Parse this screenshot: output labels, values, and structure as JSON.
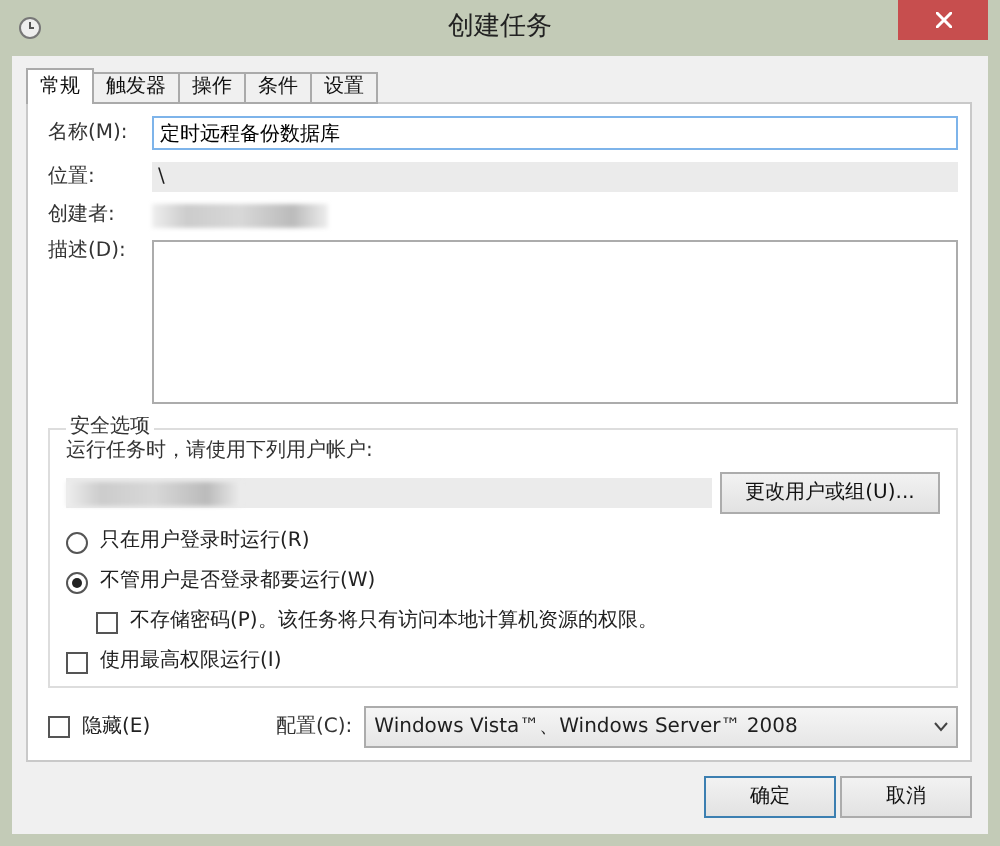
{
  "window": {
    "title": "创建任务"
  },
  "tabs": [
    {
      "label": "常规",
      "selected": true
    },
    {
      "label": "触发器",
      "selected": false
    },
    {
      "label": "操作",
      "selected": false
    },
    {
      "label": "条件",
      "selected": false
    },
    {
      "label": "设置",
      "selected": false
    }
  ],
  "general": {
    "name_label": "名称(M):",
    "name_value": "定时远程备份数据库",
    "location_label": "位置:",
    "location_value": "\\",
    "creator_label": "创建者:",
    "description_label": "描述(D):"
  },
  "security": {
    "title": "安全选项",
    "run_as_label": "运行任务时，请使用下列用户帐户:",
    "change_button": "更改用户或组(U)...",
    "run_options": [
      {
        "label": "只在用户登录时运行(R)",
        "selected": false
      },
      {
        "label": "不管用户是否登录都要运行(W)",
        "selected": true
      }
    ],
    "no_store_password": {
      "label": "不存储密码(P)。该任务将只有访问本地计算机资源的权限。",
      "checked": false
    },
    "highest_privileges": {
      "label": "使用最高权限运行(I)",
      "checked": false
    }
  },
  "hidden": {
    "label": "隐藏(E)",
    "checked": false
  },
  "config": {
    "label": "配置(C):",
    "value": "Windows Vista™、Windows Server™ 2008"
  },
  "buttons": [
    {
      "label": "确定",
      "default": true
    },
    {
      "label": "取消",
      "default": false
    }
  ]
}
